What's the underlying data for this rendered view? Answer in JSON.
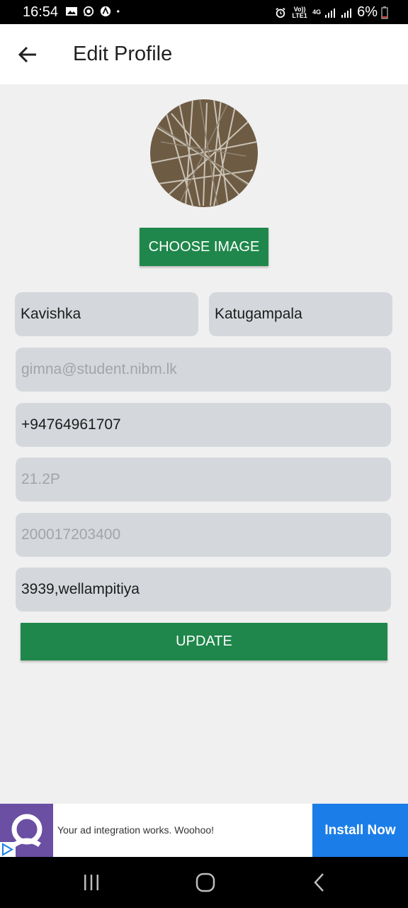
{
  "status_bar": {
    "time": "16:54",
    "battery": "6%",
    "network": "4G",
    "volte": "Vo)) LTE1"
  },
  "app_bar": {
    "title": "Edit Profile"
  },
  "profile": {
    "choose_image_label": "CHOOSE IMAGE",
    "first_name": "Kavishka",
    "last_name": "Katugampala",
    "email": "gimna@student.nibm.lk",
    "phone": "+94764961707",
    "batch": "21.2P",
    "nic": "200017203400",
    "address": "3939,wellampitiya",
    "update_label": "UPDATE"
  },
  "ad": {
    "text": "Your ad integration works. Woohoo!",
    "cta": "Install Now"
  },
  "colors": {
    "primary_green": "#1f874b",
    "field_bg": "#d4d8dc",
    "ad_blue": "#1b7de8",
    "ad_purple": "#6b4fa3"
  }
}
